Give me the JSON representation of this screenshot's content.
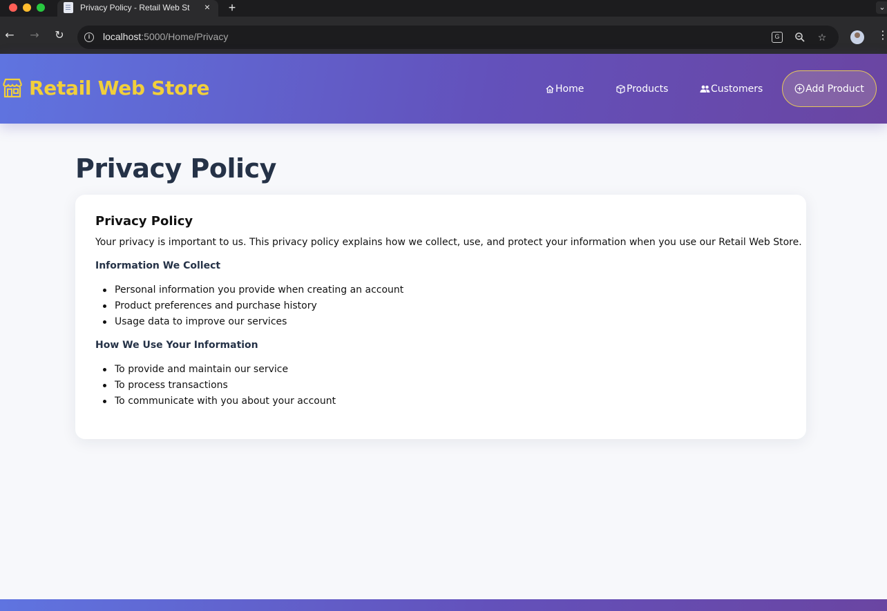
{
  "browser": {
    "tab_title": "Privacy Policy - Retail Web St",
    "tab_close": "×",
    "new_tab": "+",
    "url_host": "localhost",
    "url_path": ":5000/Home/Privacy",
    "icons": [
      "back-arrow-icon",
      "forward-arrow-icon",
      "reload-icon",
      "site-info-icon",
      "translate-icon",
      "zoom-icon",
      "bookmark-star-icon",
      "profile-avatar",
      "menu-kebab-icon"
    ]
  },
  "header": {
    "brand_name": "Retail Web Store",
    "brand_color": "#f1cf3b",
    "nav": {
      "home": "Home",
      "products": "Products",
      "customers": "Customers"
    },
    "add_product": "Add Product",
    "gradient": [
      "#5f74e0",
      "#6351bb",
      "#6a45a2"
    ]
  },
  "main": {
    "page_title": "Privacy Policy",
    "card": {
      "title": "Privacy Policy",
      "intro": "Your privacy is important to us. This privacy policy explains how we collect, use, and protect your information when you use our Retail Web Store.",
      "sections": [
        {
          "heading": "Information We Collect",
          "items": [
            "Personal information you provide when creating an account",
            "Product preferences and purchase history",
            "Usage data to improve our services"
          ]
        },
        {
          "heading": "How We Use Your Information",
          "items": [
            "To provide and maintain our service",
            "To process transactions",
            "To communicate with you about your account"
          ]
        }
      ]
    }
  }
}
